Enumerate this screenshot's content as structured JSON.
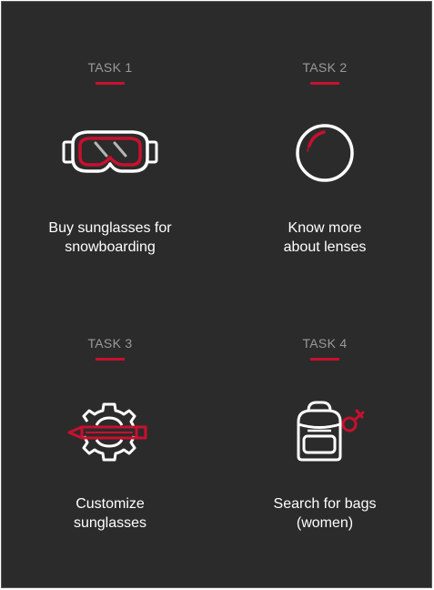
{
  "tasks": [
    {
      "label": "TASK 1",
      "title_line1": "Buy sunglasses for",
      "title_line2": "snowboarding",
      "icon": "goggles-icon"
    },
    {
      "label": "TASK 2",
      "title_line1": "Know more",
      "title_line2": "about lenses",
      "icon": "lens-icon"
    },
    {
      "label": "TASK 3",
      "title_line1": "Customize",
      "title_line2": "sunglasses",
      "icon": "gear-pencil-icon"
    },
    {
      "label": "TASK 4",
      "title_line1": "Search for bags",
      "title_line2": "(women)",
      "icon": "backpack-female-icon"
    }
  ],
  "colors": {
    "background": "#2b2b2b",
    "accent": "#c8102e",
    "label": "#9a9a9a",
    "text": "#ffffff"
  }
}
